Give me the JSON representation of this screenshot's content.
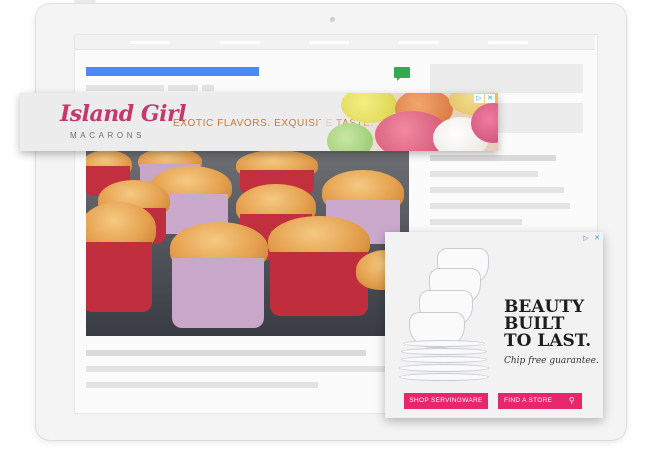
{
  "leaderboard_ad": {
    "brand_main": "Island Girl",
    "brand_sub": "MACARONS",
    "tagline": "EXOTIC FLAVORS. EXQUISITE TASTE.",
    "adchoices_icon": "adchoices-icon",
    "close_icon": "close-icon",
    "adchoices_glyph": "▷",
    "close_glyph": "✕"
  },
  "rectangle_ad": {
    "headline_line1": "BEAUTY",
    "headline_line2": "BUILT",
    "headline_line3": "TO LAST.",
    "subline": "Chip free guarantee.",
    "shop_button_label": "SHOP SERVINGWARE",
    "store_button_label": "FIND A STORE",
    "search_glyph": "⚲",
    "adchoices_glyph": "▷",
    "close_glyph": "✕"
  },
  "colors": {
    "brand_pink": "#c4386a",
    "tagline_orange": "#c8793c",
    "headline_blue": "#4a8af4",
    "comment_green": "#34a853",
    "cta_pink": "#e6276c"
  },
  "icons": {
    "comment": "comment-icon",
    "search": "search-icon"
  }
}
